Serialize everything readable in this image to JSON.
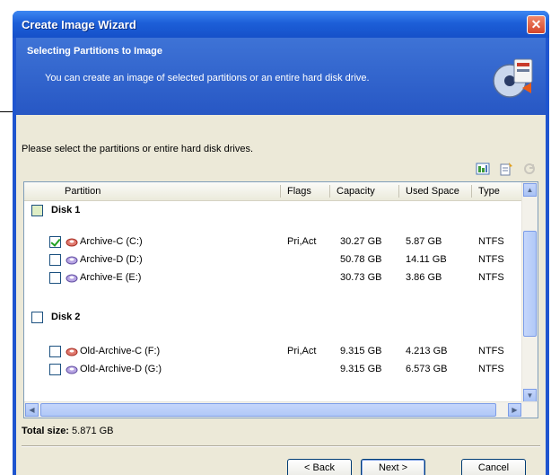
{
  "window": {
    "title": "Create Image Wizard",
    "close_glyph": "✕"
  },
  "header": {
    "title": "Selecting Partitions to Image",
    "subtitle": "You can create an image of selected partitions or an entire hard disk drive."
  },
  "instruction": "Please select the partitions or entire hard disk drives.",
  "toolbar_icons": [
    "details-view-icon",
    "properties-icon",
    "refresh-icon"
  ],
  "columns": [
    "Partition",
    "Flags",
    "Capacity",
    "Used Space",
    "Type"
  ],
  "disks": [
    {
      "label": "Disk 1",
      "checked": false,
      "partitions": [
        {
          "name": "Archive-C (C:)",
          "flags": "Pri,Act",
          "capacity": "30.27 GB",
          "used": "5.87 GB",
          "type": "NTFS",
          "checked": true,
          "icon_color": "#d13b2f"
        },
        {
          "name": "Archive-D (D:)",
          "flags": "",
          "capacity": "50.78 GB",
          "used": "14.11 GB",
          "type": "NTFS",
          "checked": false,
          "icon_color": "#8a6fc7"
        },
        {
          "name": "Archive-E (E:)",
          "flags": "",
          "capacity": "30.73 GB",
          "used": "3.86 GB",
          "type": "NTFS",
          "checked": false,
          "icon_color": "#8a6fc7"
        }
      ]
    },
    {
      "label": "Disk 2",
      "checked": false,
      "partitions": [
        {
          "name": "Old-Archive-C (F:)",
          "flags": "Pri,Act",
          "capacity": "9.315 GB",
          "used": "4.213 GB",
          "type": "NTFS",
          "checked": false,
          "icon_color": "#d13b2f"
        },
        {
          "name": "Old-Archive-D (G:)",
          "flags": "",
          "capacity": "9.315 GB",
          "used": "6.573 GB",
          "type": "NTFS",
          "checked": false,
          "icon_color": "#8a6fc7"
        }
      ]
    }
  ],
  "total": {
    "label": "Total size:",
    "value": "5.871 GB"
  },
  "buttons": {
    "back": "< Back",
    "next": "Next >",
    "cancel": "Cancel"
  }
}
